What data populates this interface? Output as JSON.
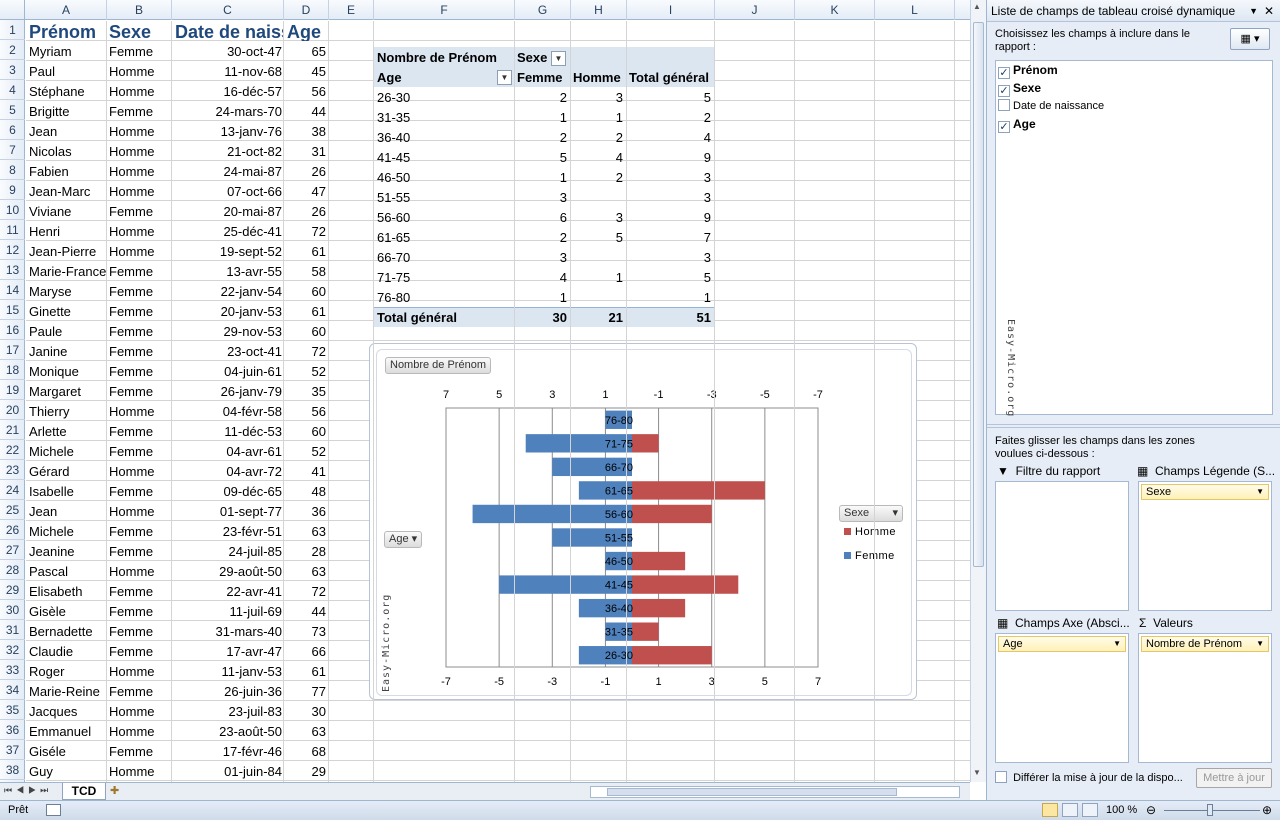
{
  "columns": [
    "A",
    "B",
    "C",
    "D",
    "E",
    "F",
    "G",
    "H",
    "I",
    "J",
    "K",
    "L"
  ],
  "headers": {
    "prenom": "Prénom",
    "sexe": "Sexe",
    "date": "Date de naissance",
    "age": "Age"
  },
  "rows": [
    [
      "Myriam",
      "Femme",
      "30-oct-47",
      "65"
    ],
    [
      "Paul",
      "Homme",
      "11-nov-68",
      "45"
    ],
    [
      "Stéphane",
      "Homme",
      "16-déc-57",
      "56"
    ],
    [
      "Brigitte",
      "Femme",
      "24-mars-70",
      "44"
    ],
    [
      "Jean",
      "Homme",
      "13-janv-76",
      "38"
    ],
    [
      "Nicolas",
      "Homme",
      "21-oct-82",
      "31"
    ],
    [
      "Fabien",
      "Homme",
      "24-mai-87",
      "26"
    ],
    [
      "Jean-Marc",
      "Homme",
      "07-oct-66",
      "47"
    ],
    [
      "Viviane",
      "Femme",
      "20-mai-87",
      "26"
    ],
    [
      "Henri",
      "Homme",
      "25-déc-41",
      "72"
    ],
    [
      "Jean-Pierre",
      "Homme",
      "19-sept-52",
      "61"
    ],
    [
      "Marie-France",
      "Femme",
      "13-avr-55",
      "58"
    ],
    [
      "Maryse",
      "Femme",
      "22-janv-54",
      "60"
    ],
    [
      "Ginette",
      "Femme",
      "20-janv-53",
      "61"
    ],
    [
      "Paule",
      "Femme",
      "29-nov-53",
      "60"
    ],
    [
      "Janine",
      "Femme",
      "23-oct-41",
      "72"
    ],
    [
      "Monique",
      "Femme",
      "04-juin-61",
      "52"
    ],
    [
      "Margaret",
      "Femme",
      "26-janv-79",
      "35"
    ],
    [
      "Thierry",
      "Homme",
      "04-févr-58",
      "56"
    ],
    [
      "Arlette",
      "Femme",
      "11-déc-53",
      "60"
    ],
    [
      "Michele",
      "Femme",
      "04-avr-61",
      "52"
    ],
    [
      "Gérard",
      "Homme",
      "04-avr-72",
      "41"
    ],
    [
      "Isabelle",
      "Femme",
      "09-déc-65",
      "48"
    ],
    [
      "Jean",
      "Homme",
      "01-sept-77",
      "36"
    ],
    [
      "Michele",
      "Femme",
      "23-févr-51",
      "63"
    ],
    [
      "Jeanine",
      "Femme",
      "24-juil-85",
      "28"
    ],
    [
      "Pascal",
      "Homme",
      "29-août-50",
      "63"
    ],
    [
      "Elisabeth",
      "Femme",
      "22-avr-41",
      "72"
    ],
    [
      "Gisèle",
      "Femme",
      "11-juil-69",
      "44"
    ],
    [
      "Bernadette",
      "Femme",
      "31-mars-40",
      "73"
    ],
    [
      "Claudie",
      "Femme",
      "17-avr-47",
      "66"
    ],
    [
      "Roger",
      "Homme",
      "11-janv-53",
      "61"
    ],
    [
      "Marie-Reine",
      "Femme",
      "26-juin-36",
      "77"
    ],
    [
      "Jacques",
      "Homme",
      "23-juil-83",
      "30"
    ],
    [
      "Emmanuel",
      "Homme",
      "23-août-50",
      "63"
    ],
    [
      "Giséle",
      "Femme",
      "17-févr-46",
      "68"
    ],
    [
      "Guy",
      "Homme",
      "01-juin-84",
      "29"
    ]
  ],
  "pivot": {
    "title": "Nombre de Prénom",
    "col_field": "Sexe",
    "row_field": "Age",
    "col_headers": [
      "Femme",
      "Homme",
      "Total général"
    ],
    "rows": [
      [
        "26-30",
        "2",
        "3",
        "5"
      ],
      [
        "31-35",
        "1",
        "1",
        "2"
      ],
      [
        "36-40",
        "2",
        "2",
        "4"
      ],
      [
        "41-45",
        "5",
        "4",
        "9"
      ],
      [
        "46-50",
        "1",
        "2",
        "3"
      ],
      [
        "51-55",
        "3",
        "",
        "3"
      ],
      [
        "56-60",
        "6",
        "3",
        "9"
      ],
      [
        "61-65",
        "2",
        "5",
        "7"
      ],
      [
        "66-70",
        "3",
        "",
        "3"
      ],
      [
        "71-75",
        "4",
        "1",
        "5"
      ],
      [
        "76-80",
        "1",
        "",
        "1"
      ]
    ],
    "total": [
      "Total général",
      "30",
      "21",
      "51"
    ]
  },
  "chart_data": {
    "type": "bar",
    "orientation": "horizontal",
    "categories": [
      "26-30",
      "31-35",
      "36-40",
      "41-45",
      "46-50",
      "51-55",
      "56-60",
      "61-65",
      "66-70",
      "71-75",
      "76-80"
    ],
    "series": [
      {
        "name": "Homme",
        "color": "#c0504d",
        "values": [
          3,
          1,
          2,
          4,
          2,
          0,
          3,
          5,
          0,
          1,
          0
        ]
      },
      {
        "name": "Femme",
        "color": "#4f81bd",
        "values": [
          -2,
          -1,
          -2,
          -5,
          -1,
          -3,
          -6,
          -2,
          -3,
          -4,
          -1
        ]
      }
    ],
    "xlim": [
      -7,
      7
    ],
    "top_ticks": [
      "7",
      "5",
      "3",
      "1",
      "-1",
      "-3",
      "-5",
      "-7"
    ],
    "bottom_ticks": [
      "-7",
      "-5",
      "-3",
      "-1",
      "1",
      "3",
      "5",
      "7"
    ],
    "field_button": "Nombre de Prénom",
    "axis_button": "Age",
    "legend_button": "Sexe",
    "watermark": "Easy-Micro.org"
  },
  "sheet_tab": "TCD",
  "status": {
    "ready": "Prêt",
    "zoom": "100 %"
  },
  "panel": {
    "title": "Liste de champs de tableau croisé dynamique",
    "choose_label": "Choisissez les champs à inclure dans le rapport :",
    "fields": [
      {
        "label": "Prénom",
        "checked": true
      },
      {
        "label": "Sexe",
        "checked": true
      },
      {
        "label": "Date de naissance",
        "checked": false
      },
      {
        "label": "Age",
        "checked": true
      }
    ],
    "watermark": "Easy-Micro.org",
    "drag_label": "Faites glisser les champs dans les zones voulues ci-dessous :",
    "zone_filter": "Filtre du rapport",
    "zone_legend": "Champs Légende (S...",
    "zone_axis": "Champs Axe (Absci...",
    "zone_values": "Valeurs",
    "chip_legend": "Sexe",
    "chip_axis": "Age",
    "chip_values": "Nombre de Prénom",
    "defer_label": "Différer la mise à jour de la dispo...",
    "update_button": "Mettre à jour"
  }
}
